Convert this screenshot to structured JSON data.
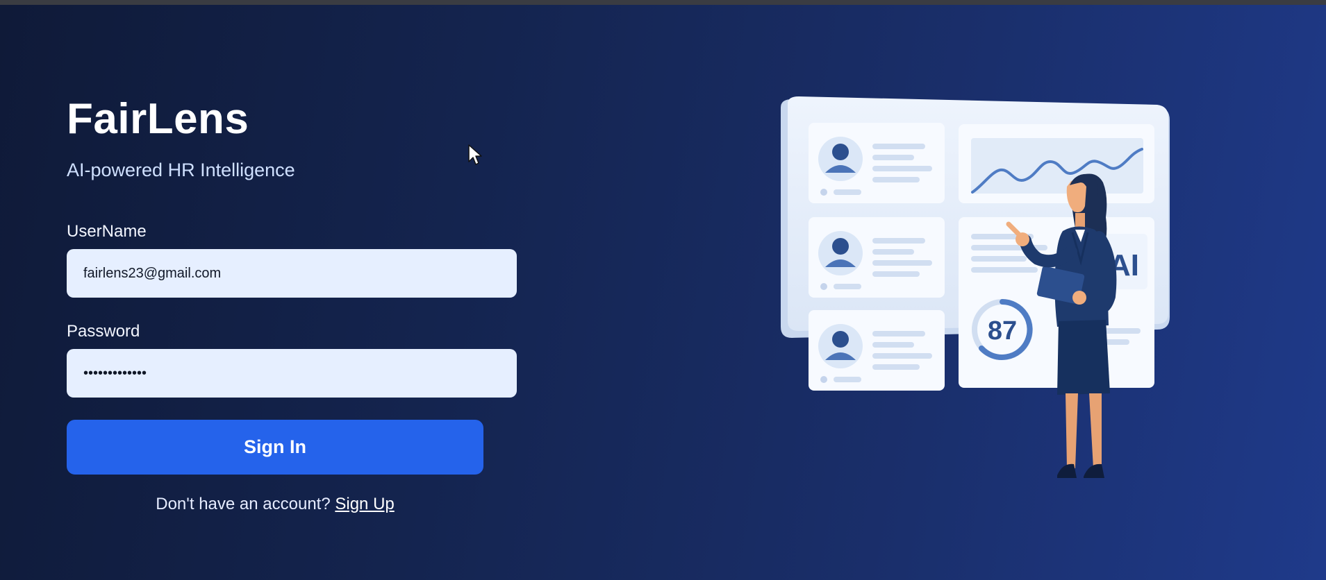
{
  "brand": {
    "title": "FairLens",
    "subtitle": "AI-powered HR Intelligence"
  },
  "login_form": {
    "username_label": "UserName",
    "username_value": "fairlens23@gmail.com",
    "password_label": "Password",
    "password_value": "fairlens23abc",
    "submit_label": "Sign In",
    "signup_prompt": "Don't have an account?",
    "signup_link": "Sign Up"
  },
  "illustration": {
    "score_value": "87",
    "ai_label": "AI"
  },
  "colors": {
    "primary_button": "#2563eb",
    "input_background": "#e6efff",
    "background_dark": "#0f1a38",
    "background_light": "#1f3a8a"
  }
}
